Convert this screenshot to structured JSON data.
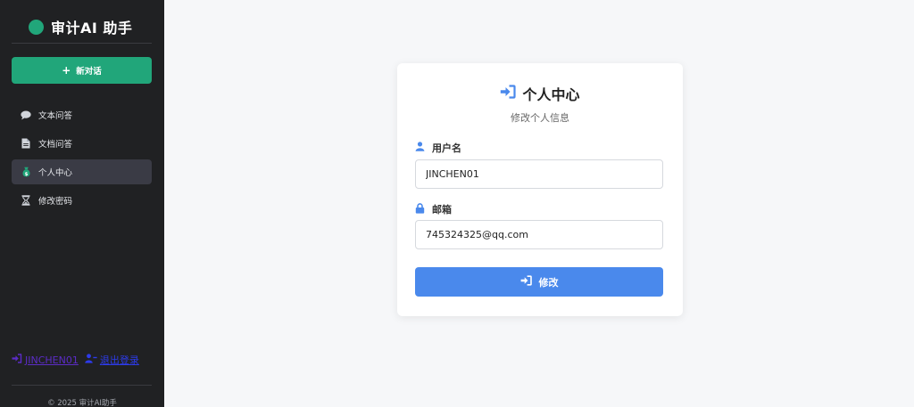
{
  "sidebar": {
    "brand": {
      "title": "审计AI 助手",
      "color": "#21a67a"
    },
    "new_chat": {
      "label": "新对话",
      "icon": "plus-icon"
    },
    "items": [
      {
        "label": "文本问答",
        "icon": "comment-icon",
        "active": false
      },
      {
        "label": "文档问答",
        "icon": "file-icon",
        "active": false
      },
      {
        "label": "个人中心",
        "icon": "money-bag-icon",
        "active": true
      },
      {
        "label": "修改密码",
        "icon": "hourglass-icon",
        "active": false
      }
    ],
    "user": {
      "name": "JINCHEN01",
      "logout_label": "退出登录"
    },
    "footer": "© 2025 审计AI助手"
  },
  "card": {
    "title": "个人中心",
    "subtitle": "修改个人信息",
    "username": {
      "label": "用户名",
      "value": "JINCHEN01"
    },
    "email": {
      "label": "邮箱",
      "value": "745324325@qq.com"
    },
    "submit_label": "修改"
  },
  "colors": {
    "accent_green": "#21a67a",
    "primary_blue": "#4a89ec",
    "sidebar_bg": "#202123"
  }
}
